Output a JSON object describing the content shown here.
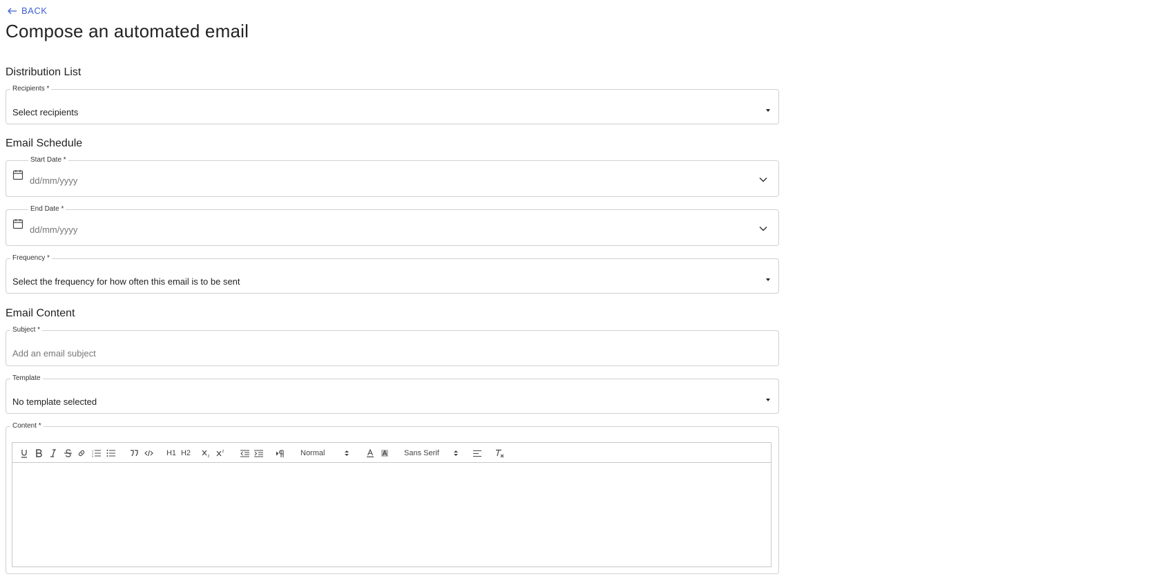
{
  "nav": {
    "back_label": "BACK"
  },
  "page": {
    "title": "Compose an automated email"
  },
  "sections": {
    "distribution": "Distribution List",
    "schedule": "Email Schedule",
    "content": "Email Content"
  },
  "fields": {
    "recipients": {
      "label": "Recipients *",
      "value": "Select recipients"
    },
    "start_date": {
      "label": "Start Date *",
      "placeholder": "dd/mm/yyyy"
    },
    "end_date": {
      "label": "End Date *",
      "placeholder": "dd/mm/yyyy"
    },
    "frequency": {
      "label": "Frequency *",
      "value": "Select the frequency for how often this email is to be sent"
    },
    "subject": {
      "label": "Subject *",
      "placeholder": "Add an email subject"
    },
    "template": {
      "label": "Template",
      "value": "No template selected"
    },
    "content": {
      "label": "Content *"
    }
  },
  "editor": {
    "header_select": "Normal",
    "font_select": "Sans Serif",
    "h1": "H1",
    "h2": "H2"
  },
  "colors": {
    "accent": "#3d5fcf",
    "border": "#d0d0d0"
  }
}
